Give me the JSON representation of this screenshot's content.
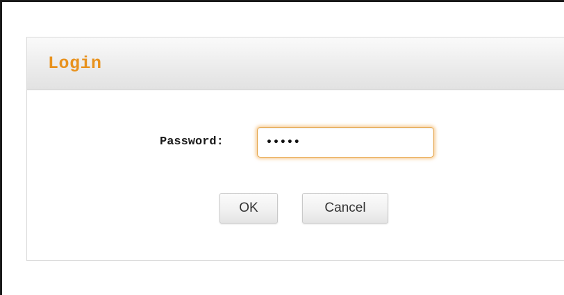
{
  "dialog": {
    "title": "Login",
    "password_label": "Password:",
    "password_value": "•••••",
    "ok_label": "OK",
    "cancel_label": "Cancel"
  },
  "colors": {
    "title": "#e8921e",
    "input_focus_glow": "#f0a546",
    "header_background": "#ececec",
    "button_background": "#f1f1f1"
  }
}
